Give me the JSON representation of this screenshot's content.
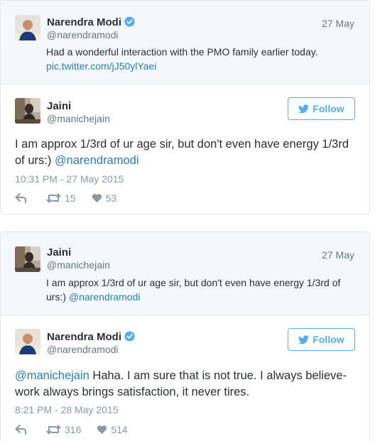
{
  "tweet1": {
    "context": {
      "name": "Narendra Modi",
      "handle": "@narendramodi",
      "date": "27 May",
      "text": "Had a wonderful interaction with the PMO family earlier today.",
      "link": "pic.twitter.com/jJ50ylYaei"
    },
    "main": {
      "name": "Jaini",
      "handle": "@manichejain",
      "follow_label": "Follow",
      "text": "I am approx 1/3rd of ur age sir, but don't even have energy 1/3rd of urs:) ",
      "mention": "@narendramodi",
      "timestamp": "10:31 PM - 27 May 2015",
      "retweets": "15",
      "likes": "53"
    }
  },
  "tweet2": {
    "context": {
      "name": "Jaini",
      "handle": "@manichejain",
      "date": "27 May",
      "text": "I am approx 1/3rd of ur age sir, but don't even have energy 1/3rd of urs:) ",
      "mention": "@narendramodi"
    },
    "main": {
      "name": "Narendra Modi",
      "handle": "@narendramodi",
      "follow_label": "Follow",
      "mention": "@manichejain",
      "text": " Haha. I am sure that is not true. I always believe- work always brings satisfaction, it never tires.",
      "timestamp": "8:21 PM - 28 May 2015",
      "retweets": "316",
      "likes": "514"
    }
  },
  "icons": {
    "verified": "verified-badge-icon",
    "reply": "reply-icon",
    "retweet": "retweet-icon",
    "like": "heart-icon",
    "bird": "twitter-bird-icon"
  },
  "colors": {
    "link": "#2b7bb9",
    "follow": "#55acee",
    "muted": "#8899a6",
    "context_bg": "#f5f8fa"
  }
}
